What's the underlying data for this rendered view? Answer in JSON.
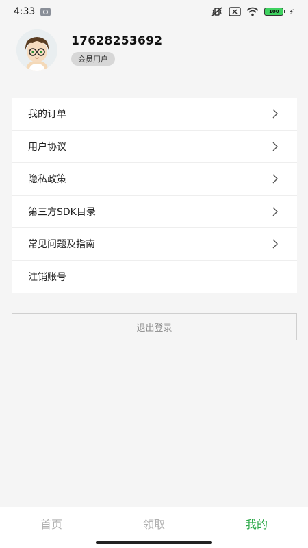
{
  "status": {
    "time": "4:33",
    "battery": "100"
  },
  "profile": {
    "phone": "17628253692",
    "badge": "会员用户"
  },
  "menu": [
    {
      "label": "我的订单",
      "arrow": true
    },
    {
      "label": "用户协议",
      "arrow": true
    },
    {
      "label": "隐私政策",
      "arrow": true
    },
    {
      "label": "第三方SDK目录",
      "arrow": true
    },
    {
      "label": "常见问题及指南",
      "arrow": true
    },
    {
      "label": "注销账号",
      "arrow": false
    }
  ],
  "logout_label": "退出登录",
  "tabs": [
    {
      "label": "首页",
      "active": false
    },
    {
      "label": "领取",
      "active": false
    },
    {
      "label": "我的",
      "active": true
    }
  ],
  "colors": {
    "accent": "#28a745",
    "inactive": "#b0b0b0",
    "background": "#f5f5f5"
  }
}
